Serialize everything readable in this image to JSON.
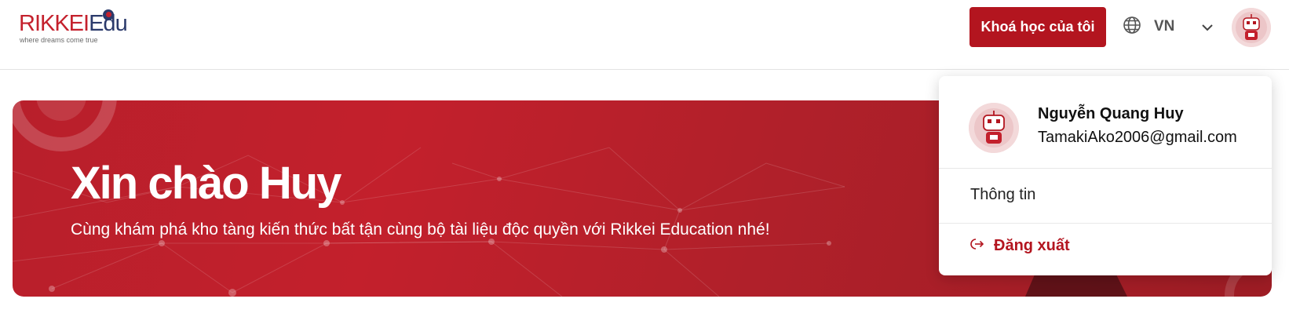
{
  "header": {
    "logo": {
      "brand_prefix": "RIKKEI",
      "brand_suffix": "Edu",
      "tagline": "where dreams come true"
    },
    "my_courses_label": "Khoá học của tôi",
    "language": {
      "icon": "globe-icon",
      "label": "VN"
    },
    "chevron_icon": "chevron-down-icon",
    "avatar_icon": "robot-avatar"
  },
  "banner": {
    "title": "Xin chào Huy",
    "subtitle": "Cùng khám phá kho tàng kiến thức bất tận cùng bộ tài liệu độc quyền với Rikkei Education nhé!"
  },
  "user_menu": {
    "name": "Nguyễn Quang Huy",
    "email": "TamakiAko2006@gmail.com",
    "info_label": "Thông tin",
    "logout_label": "Đăng xuất",
    "logout_icon": "logout-icon"
  },
  "colors": {
    "brand_red": "#b3151f",
    "banner_red": "#c3202c",
    "brand_navy": "#2b3a6b"
  }
}
